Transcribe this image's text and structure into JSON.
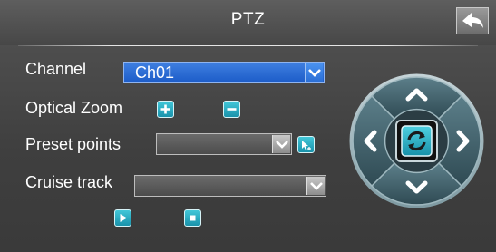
{
  "window": {
    "title": "PTZ"
  },
  "icons": {
    "back": "back-arrow-icon",
    "zoom_in": "plus-icon",
    "zoom_out": "minus-icon",
    "preset_go": "preset-pointer-icon",
    "cruise_start": "play-icon",
    "cruise_stop": "stop-icon",
    "pad_up": "chevron-up-icon",
    "pad_down": "chevron-down-icon",
    "pad_left": "chevron-left-icon",
    "pad_right": "chevron-right-icon",
    "pad_center": "refresh-icon"
  },
  "colors": {
    "accent_button": "#1fa3bd",
    "selected_field": "#2568d6"
  },
  "channel": {
    "label": "Channel",
    "value": "Ch01"
  },
  "zoom": {
    "label": "Optical Zoom"
  },
  "preset": {
    "label": "Preset points",
    "value": ""
  },
  "cruise": {
    "label": "Cruise track",
    "value": ""
  }
}
